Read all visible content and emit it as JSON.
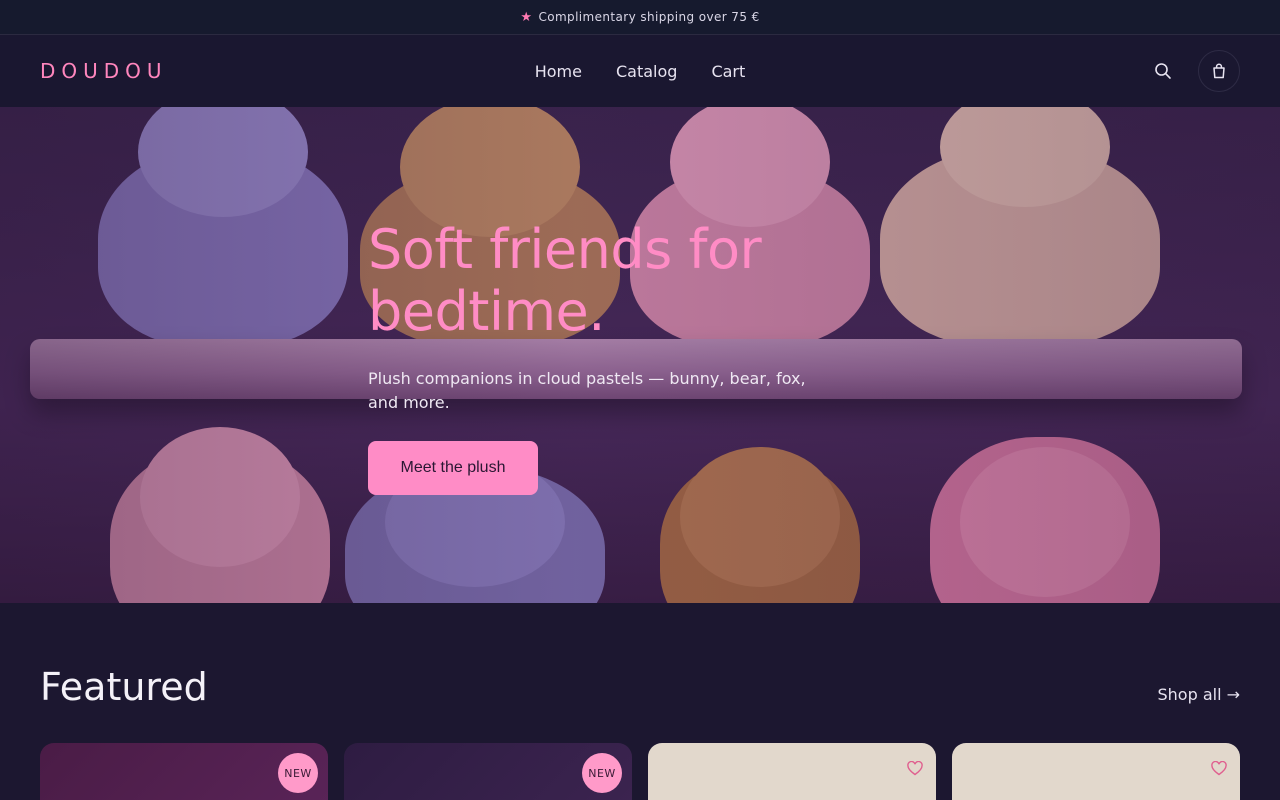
{
  "announcement": {
    "icon": "star-icon",
    "text": "Complimentary shipping over 75 €"
  },
  "header": {
    "logo": "DOUDOU",
    "nav": [
      "Home",
      "Catalog",
      "Cart"
    ],
    "search_icon": "search-icon",
    "cart_icon": "shopping-bag-icon"
  },
  "hero": {
    "title": "Soft friends for bedtime.",
    "subtitle": "Plush companions in cloud pastels — bunny, bear, fox, and more.",
    "cta": "Meet the plush"
  },
  "featured": {
    "title": "Featured",
    "shop_all": "Shop all →",
    "cards": [
      {
        "badge": "NEW"
      },
      {
        "badge": "NEW"
      },
      {
        "favorite_icon": "heart-icon"
      },
      {
        "favorite_icon": "heart-icon"
      }
    ]
  },
  "colors": {
    "accent": "#ff8cc6",
    "background": "#1c1730",
    "logo": "#ff86bd"
  }
}
